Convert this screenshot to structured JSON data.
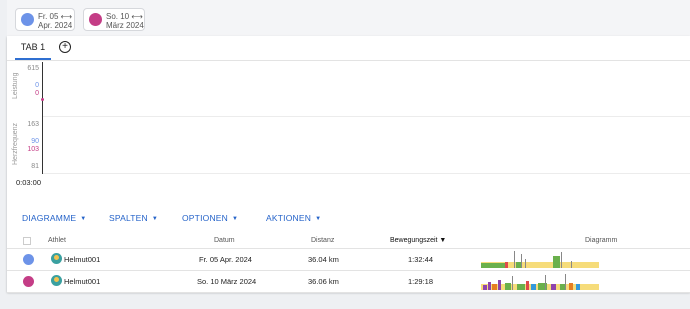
{
  "compare": [
    {
      "color": "#6d93e8",
      "line1": "Fr. 05 ⟷",
      "line2": "Apr. 2024"
    },
    {
      "color": "#c43d86",
      "line1": "So. 10 ⟷",
      "line2": "März 2024"
    }
  ],
  "tabs": {
    "tab1": "TAB 1",
    "add_icon": "plus-circle-icon"
  },
  "chart": {
    "leistung_label": "Leistung",
    "herz_label": "Herzfrequenz",
    "leistung_max": "615",
    "leistung_val_a": "0",
    "leistung_val_b": "0",
    "herz_max": "163",
    "herz_val_a": "90",
    "herz_val_b": "103",
    "herz_min": "81",
    "time": "0:03:00",
    "color_a": "#6d93e8",
    "color_b": "#c43d86"
  },
  "menu": {
    "diagramme": "DIAGRAMME",
    "spalten": "SPALTEN",
    "optionen": "OPTIONEN",
    "aktionen": "AKTIONEN"
  },
  "table": {
    "headers": {
      "athlet": "Athlet",
      "datum": "Datum",
      "distanz": "Distanz",
      "bewegungszeit": "Bewegungszeit ▼",
      "diagramm": "Diagramm"
    },
    "rows": [
      {
        "color": "#6d93e8",
        "athlet": "Helmut001",
        "datum": "Fr. 05 Apr. 2024",
        "distanz": "36.04 km",
        "zeit": "1:32:44"
      },
      {
        "color": "#c43d86",
        "athlet": "Helmut001",
        "datum": "So. 10 März 2024",
        "distanz": "36.06 km",
        "zeit": "1:29:18"
      }
    ]
  }
}
